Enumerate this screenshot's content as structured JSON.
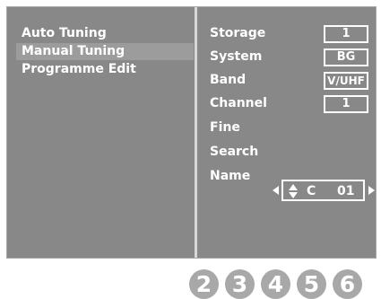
{
  "menu": {
    "items": [
      {
        "label": "Auto Tuning"
      },
      {
        "label": "Manual Tuning"
      },
      {
        "label": "Programme Edit"
      }
    ]
  },
  "params": {
    "storage": {
      "label": "Storage",
      "value": "1"
    },
    "system": {
      "label": "System",
      "value": "BG"
    },
    "band": {
      "label": "Band",
      "value": "V/UHF"
    },
    "channel": {
      "label": "Channel",
      "value": "1"
    },
    "fine": {
      "label": "Fine"
    },
    "search": {
      "label": "Search"
    },
    "name": {
      "label": "Name",
      "char": "C",
      "number": "01"
    }
  },
  "badges": [
    "2",
    "3",
    "4",
    "5",
    "6"
  ],
  "colors": {
    "osd_bg": "#888888",
    "selected_bg": "#9c9c9c",
    "text": "#ffffff",
    "badge": "#a8a8a8"
  }
}
